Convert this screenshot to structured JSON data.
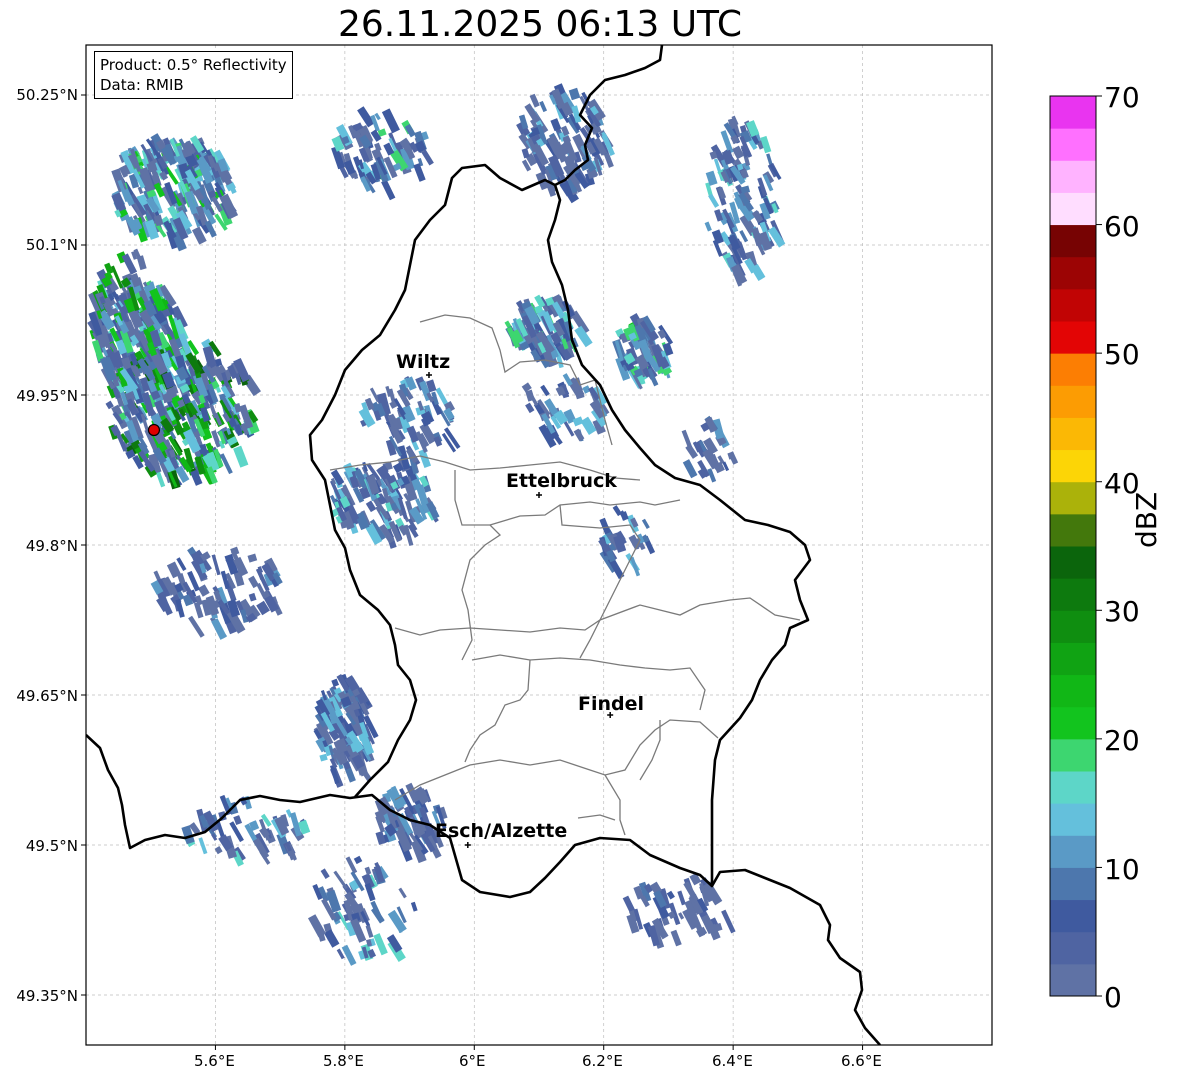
{
  "title": "26.11.2025 06:13 UTC",
  "info": {
    "product": "Product: 0.5° Reflectivity",
    "source": "Data: RMIB"
  },
  "axes": {
    "x_ticks": [
      "5.6°E",
      "5.8°E",
      "6°E",
      "6.2°E",
      "6.4°E",
      "6.6°E"
    ],
    "y_ticks": [
      "50.25°N",
      "50.1°N",
      "49.95°N",
      "49.8°N",
      "49.65°N",
      "49.5°N",
      "49.35°N"
    ],
    "lon_range": [
      5.4,
      6.8
    ],
    "lat_range": [
      49.3,
      50.3
    ]
  },
  "colorbar": {
    "label": "dBZ",
    "ticks": [
      "0",
      "10",
      "20",
      "30",
      "40",
      "50",
      "60",
      "70"
    ],
    "range": [
      0,
      70
    ],
    "colors": [
      "#5f72a5",
      "#4f64a2",
      "#3f5a9f",
      "#4d77ad",
      "#5a9ac6",
      "#64c0dc",
      "#5dd6c8",
      "#3dd670",
      "#12c41e",
      "#11b716",
      "#10a313",
      "#0f8e10",
      "#0d7a0e",
      "#0b650c",
      "#43780c",
      "#abb20a",
      "#fcd506",
      "#fbb805",
      "#fc9c03",
      "#fc7e03",
      "#e30505",
      "#c10404",
      "#9c0404",
      "#770303",
      "#ffddff",
      "#ffb3ff",
      "#ff70ff",
      "#e934f0"
    ]
  },
  "cities": [
    {
      "name": "Wiltz",
      "lon": 5.93,
      "lat": 49.97
    },
    {
      "name": "Ettelbruck",
      "lon": 6.1,
      "lat": 49.85
    },
    {
      "name": "Findel",
      "lon": 6.21,
      "lat": 49.63
    },
    {
      "name": "Esch/Alzette",
      "lon": 5.99,
      "lat": 49.5
    }
  ],
  "radar_site": {
    "lon": 5.505,
    "lat": 49.915,
    "color": "#e00000"
  }
}
